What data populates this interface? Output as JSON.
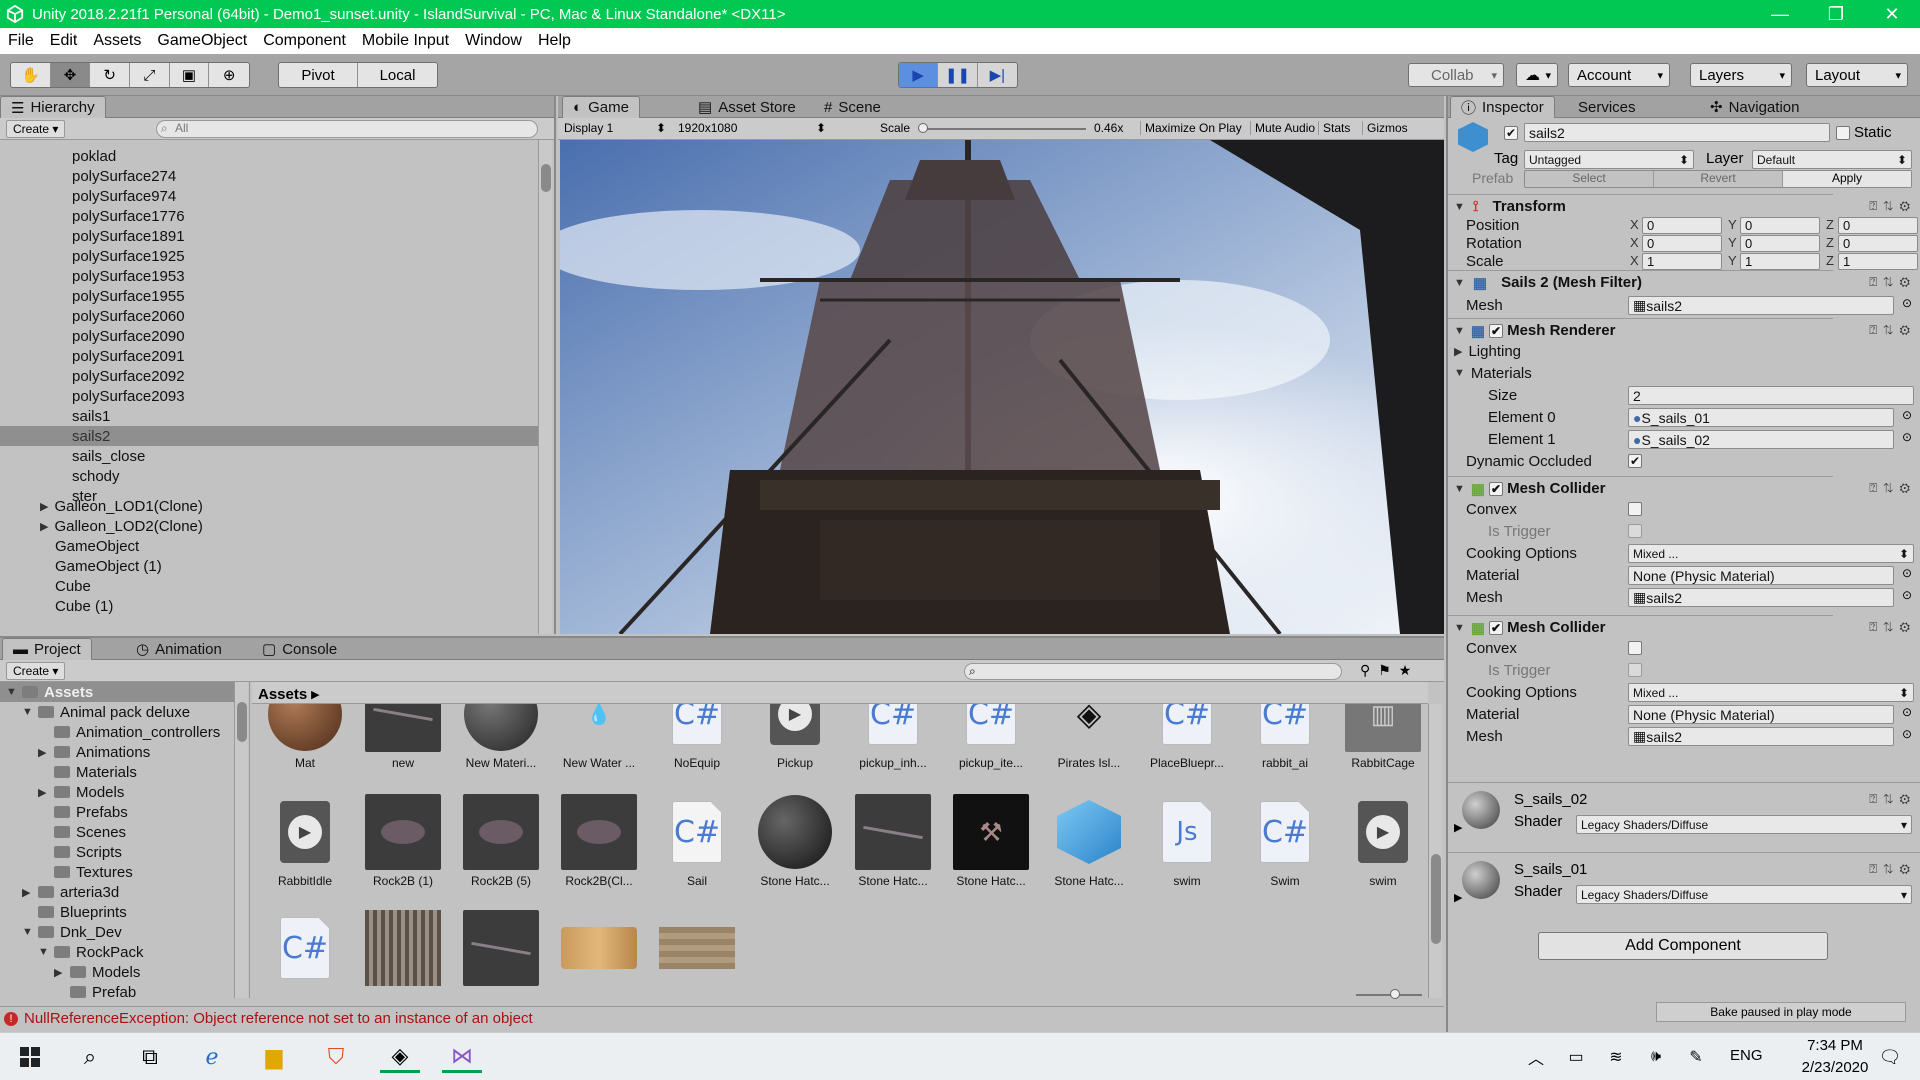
{
  "window": {
    "title": "Unity 2018.2.21f1 Personal (64bit) - Demo1_sunset.unity - IslandSurvival - PC, Mac & Linux Standalone* <DX11>"
  },
  "menu": [
    "File",
    "Edit",
    "Assets",
    "GameObject",
    "Component",
    "Mobile Input",
    "Window",
    "Help"
  ],
  "toolbar": {
    "pivot": "Pivot",
    "local": "Local",
    "collab": "Collab",
    "account": "Account",
    "layers": "Layers",
    "layout": "Layout"
  },
  "hierarchy": {
    "tab": "Hierarchy",
    "create": "Create",
    "search_placeholder": "All",
    "items": [
      "polySurface274",
      "polySurface974",
      "polySurface1776",
      "polySurface1891",
      "polySurface1925",
      "polySurface1953",
      "polySurface1955",
      "polySurface2060",
      "polySurface2090",
      "polySurface2091",
      "polySurface2092",
      "polySurface2093",
      "sails1",
      "sails2",
      "sails_close",
      "schody",
      "ster"
    ],
    "first_item": "poklad",
    "roots": [
      "Galleon_LOD1(Clone)",
      "Galleon_LOD2(Clone)",
      "GameObject",
      "GameObject (1)",
      "Cube",
      "Cube (1)"
    ],
    "selected": "sails2"
  },
  "game": {
    "tabs": [
      "Game",
      "Asset Store",
      "Scene"
    ],
    "display": "Display 1",
    "resolution": "1920x1080",
    "scale_label": "Scale",
    "scale_value": "0.46x",
    "buttons": [
      "Maximize On Play",
      "Mute Audio",
      "Stats",
      "Gizmos"
    ]
  },
  "inspector": {
    "tabs": [
      "Inspector",
      "Services",
      "Navigation"
    ],
    "object_name": "sails2",
    "static_label": "Static",
    "tag_label": "Tag",
    "tag_value": "Untagged",
    "layer_label": "Layer",
    "layer_value": "Default",
    "prefab_label": "Prefab",
    "prefab_buttons": [
      "Select",
      "Revert",
      "Apply"
    ],
    "transform": {
      "title": "Transform",
      "position": [
        "0",
        "0",
        "0"
      ],
      "rotation": [
        "0",
        "0",
        "0"
      ],
      "scale": [
        "1",
        "1",
        "1"
      ],
      "labels": [
        "Position",
        "Rotation",
        "Scale"
      ]
    },
    "mesh_filter": {
      "title": "Sails 2 (Mesh Filter)",
      "mesh_label": "Mesh",
      "mesh": "sails2"
    },
    "mesh_renderer": {
      "title": "Mesh Renderer",
      "lighting": "Lighting",
      "materials": "Materials",
      "size_label": "Size",
      "size": "2",
      "el0_label": "Element 0",
      "el0": "S_sails_01",
      "el1_label": "Element 1",
      "el1": "S_sails_02",
      "dyn_label": "Dynamic Occluded"
    },
    "collider1": {
      "title": "Mesh Collider",
      "convex": "Convex",
      "trigger": "Is Trigger",
      "cooking": "Cooking Options",
      "cooking_val": "Mixed ...",
      "material": "Material",
      "material_val": "None (Physic Material)",
      "mesh": "Mesh",
      "mesh_val": "sails2"
    },
    "collider2": {
      "title": "Mesh Collider",
      "convex": "Convex",
      "trigger": "Is Trigger",
      "cooking": "Cooking Options",
      "cooking_val": "Mixed ...",
      "material": "Material",
      "material_val": "None (Physic Material)",
      "mesh": "Mesh",
      "mesh_val": "sails2"
    },
    "mat1": {
      "name": "S_sails_02",
      "shader_label": "Shader",
      "shader": "Legacy Shaders/Diffuse"
    },
    "mat2": {
      "name": "S_sails_01",
      "shader_label": "Shader",
      "shader": "Legacy Shaders/Diffuse"
    },
    "add_component": "Add Component"
  },
  "project": {
    "tabs": [
      "Project",
      "Animation",
      "Console"
    ],
    "create": "Create",
    "breadcrumb": "Assets",
    "tree": [
      "Assets",
      "Animal pack deluxe",
      "Animation_controllers",
      "Animations",
      "Materials",
      "Models",
      "Prefabs",
      "Scenes",
      "Scripts",
      "Textures",
      "arteria3d",
      "Blueprints",
      "Dnk_Dev",
      "RockPack",
      "Models",
      "Prefab"
    ],
    "row1": [
      "Mat",
      "new",
      "New Materi...",
      "New Water ...",
      "NoEquip",
      "Pickup",
      "pickup_inh...",
      "pickup_ite...",
      "Pirates Isl...",
      "PlaceBluepr...",
      "rabbit_ai",
      "RabbitCage"
    ],
    "row2": [
      "RabbitIdle",
      "Rock2B (1)",
      "Rock2B (5)",
      "Rock2B(Cl...",
      "Sail",
      "Stone Hatc...",
      "Stone Hatc...",
      "Stone Hatc...",
      "Stone Hatc...",
      "swim",
      "Swim",
      "swim"
    ]
  },
  "status": {
    "error": "NullReferenceException: Object reference not set to an instance of an object",
    "bake": "Bake paused in play mode"
  },
  "taskbar": {
    "lang": "ENG",
    "time": "7:34 PM",
    "date": "2/23/2020"
  }
}
